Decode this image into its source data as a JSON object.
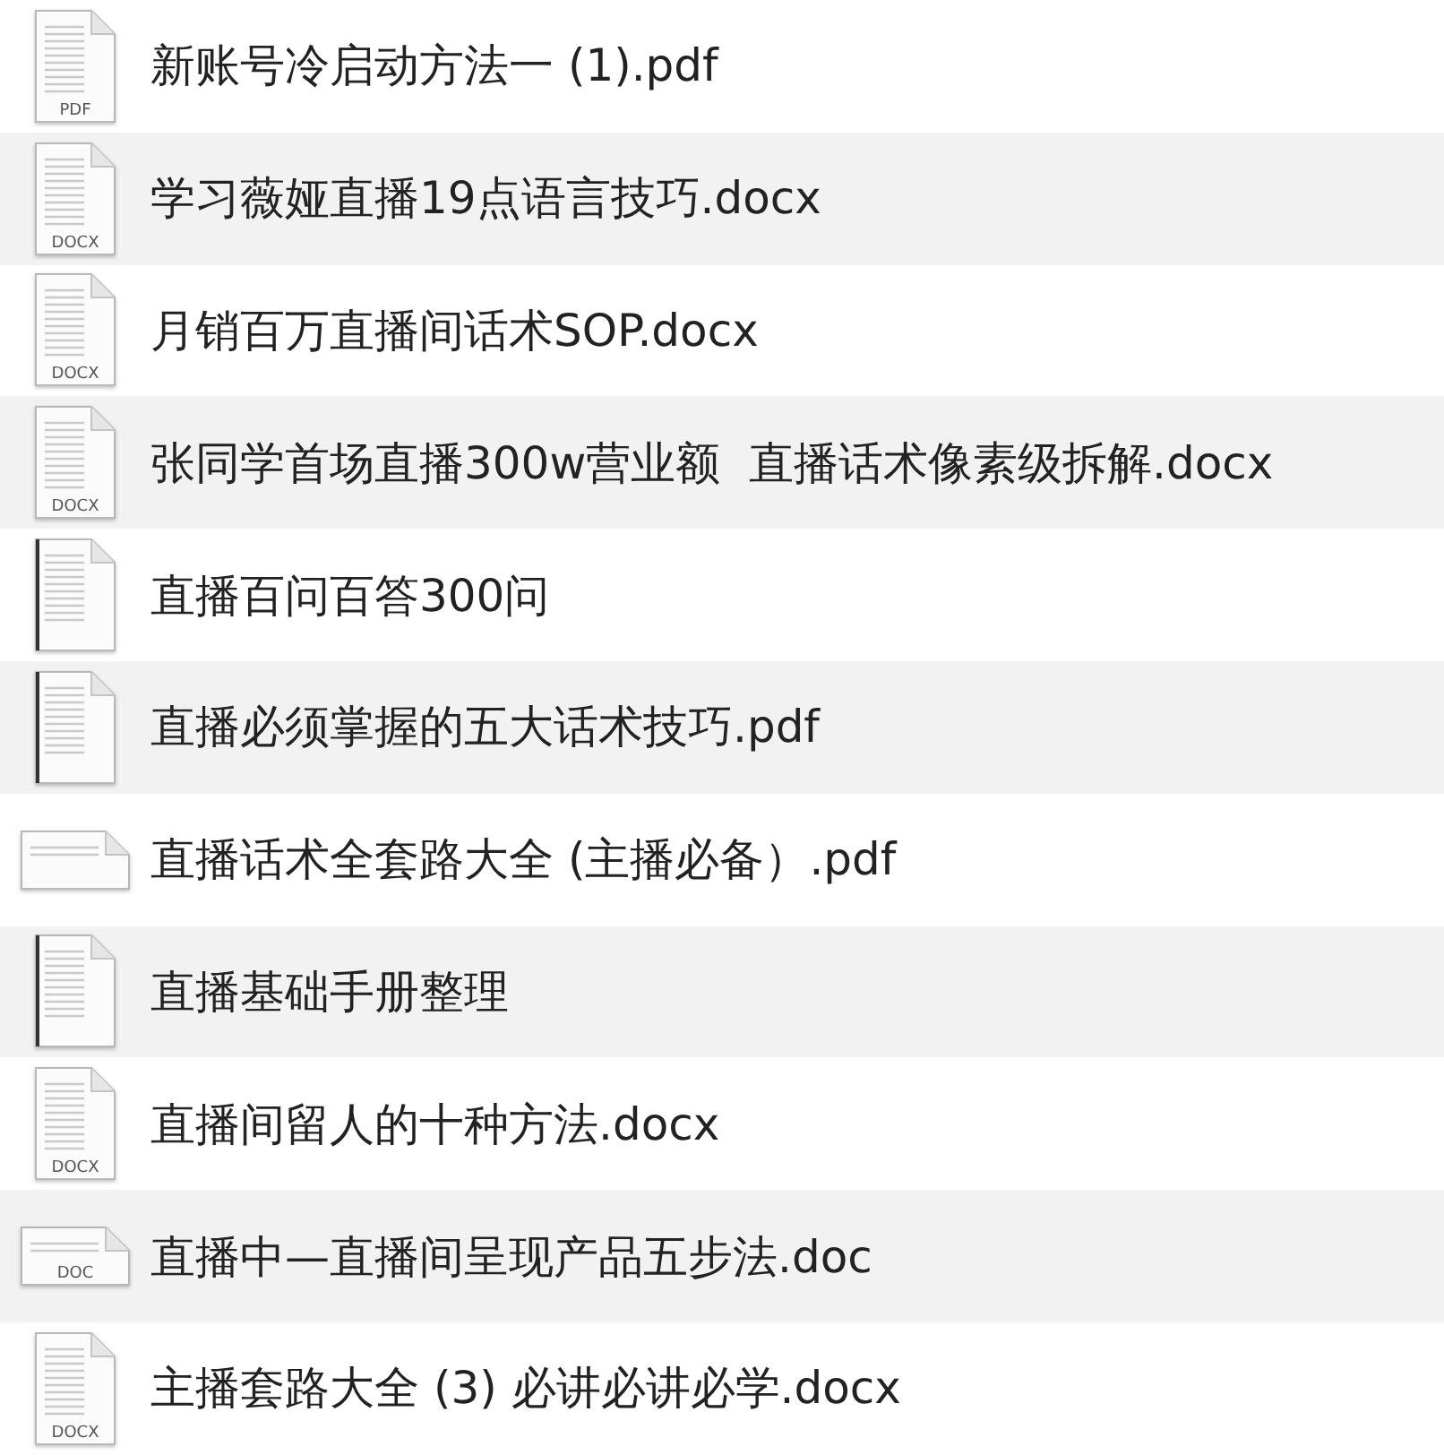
{
  "files": [
    {
      "name": "新账号冷启动方法一 (1).pdf",
      "kind": "portrait",
      "badge": "PDF"
    },
    {
      "name": "学习薇娅直播19点语言技巧.docx",
      "kind": "portrait",
      "badge": "DOCX"
    },
    {
      "name": "月销百万直播间话术SOP.docx",
      "kind": "portrait",
      "badge": "DOCX"
    },
    {
      "name": "张同学首场直播300w营业额  直播话术像素级拆解.docx",
      "kind": "portrait",
      "badge": "DOCX"
    },
    {
      "name": "直播百问百答300问",
      "kind": "portrait"
    },
    {
      "name": "直播必须掌握的五大话术技巧.pdf",
      "kind": "portrait"
    },
    {
      "name": "直播话术全套路大全 (主播必备）.pdf",
      "kind": "landscape"
    },
    {
      "name": "直播基础手册整理",
      "kind": "portrait"
    },
    {
      "name": "直播间留人的十种方法.docx",
      "kind": "portrait",
      "badge": "DOCX"
    },
    {
      "name": "直播中—直播间呈现产品五步法.doc",
      "kind": "landscape",
      "badge": "DOC"
    },
    {
      "name": "主播套路大全 (3) 必讲必讲必学.docx",
      "kind": "portrait",
      "badge": "DOCX"
    }
  ]
}
